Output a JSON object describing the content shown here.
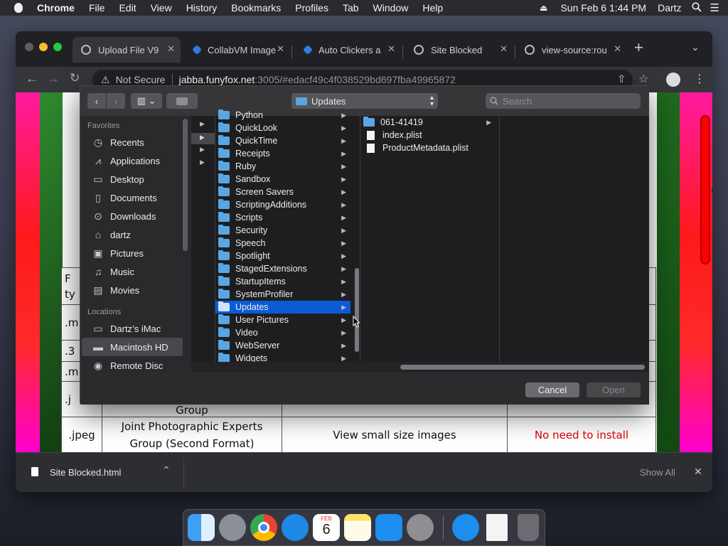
{
  "menubar": {
    "apple_icon": "apple-icon",
    "items": [
      "Chrome",
      "File",
      "Edit",
      "View",
      "History",
      "Bookmarks",
      "Profiles",
      "Tab",
      "Window",
      "Help"
    ],
    "datetime": "Sun Feb 6  1:44 PM",
    "user": "Dartz"
  },
  "browser": {
    "tabs": [
      {
        "title": "Upload File V9",
        "active": true
      },
      {
        "title": "CollabVM Image"
      },
      {
        "title": "Auto Clickers a"
      },
      {
        "title": "Site Blocked"
      },
      {
        "title": "view-source:rou"
      }
    ],
    "omnibox": {
      "security": "Not Secure",
      "host": "jabba.funyfox.net",
      "path": ":3005/#edacf49c4f038529bd697fba49965872"
    },
    "downloads": {
      "file": "Site Blocked.html",
      "show_all": "Show All"
    }
  },
  "page": {
    "table_rows": [
      {
        "c1": "F",
        "c1b": "ty"
      },
      {
        "c1": ".m"
      },
      {
        "c1": ".3"
      },
      {
        "c1": ".m"
      },
      {
        "c1": ".j",
        "c2": "Group"
      },
      {
        "c1": ".jpeg",
        "c2a": "Joint Photographic Experts",
        "c2b": "Group (Second Format)",
        "c3": "View small size images",
        "c4": "No need to install"
      }
    ],
    "side_letter": "n"
  },
  "dialog": {
    "location": "Updates",
    "search_placeholder": "Search",
    "sidebar": {
      "favorites_header": "Favorites",
      "favorites": [
        {
          "label": "Recents",
          "icon": "clock-icon"
        },
        {
          "label": "Applications",
          "icon": "applications-icon"
        },
        {
          "label": "Desktop",
          "icon": "desktop-icon"
        },
        {
          "label": "Documents",
          "icon": "document-icon"
        },
        {
          "label": "Downloads",
          "icon": "download-icon"
        },
        {
          "label": "dartz",
          "icon": "home-icon"
        },
        {
          "label": "Pictures",
          "icon": "camera-icon"
        },
        {
          "label": "Music",
          "icon": "music-icon"
        },
        {
          "label": "Movies",
          "icon": "film-icon"
        }
      ],
      "locations_header": "Locations",
      "locations": [
        {
          "label": "Dartz’s iMac",
          "icon": "computer-icon"
        },
        {
          "label": "Macintosh HD",
          "icon": "disk-icon",
          "selected": true
        },
        {
          "label": "Remote Disc",
          "icon": "disc-icon"
        }
      ]
    },
    "column2": [
      "Python",
      "QuickLook",
      "QuickTime",
      "Receipts",
      "Ruby",
      "Sandbox",
      "Screen Savers",
      "ScriptingAdditions",
      "Scripts",
      "Security",
      "Speech",
      "Spotlight",
      "StagedExtensions",
      "StartupItems",
      "SystemProfiler",
      "Updates",
      "User Pictures",
      "Video",
      "WebServer",
      "Widgets"
    ],
    "column2_selected": "Updates",
    "column3": [
      {
        "name": "061-41419",
        "type": "folder"
      },
      {
        "name": "index.plist",
        "type": "file"
      },
      {
        "name": "ProductMetadata.plist",
        "type": "file"
      }
    ],
    "buttons": {
      "cancel": "Cancel",
      "open": "Open"
    }
  },
  "dock": {
    "apps": [
      "finder-icon",
      "launchpad-icon",
      "chrome-icon",
      "safari-icon",
      "calendar-icon",
      "notes-icon",
      "app-store-icon",
      "system-preferences-icon",
      "downloads-stack-icon",
      "html-file-icon",
      "trash-icon"
    ],
    "calendar": {
      "month": "FEB",
      "day": "6"
    }
  }
}
